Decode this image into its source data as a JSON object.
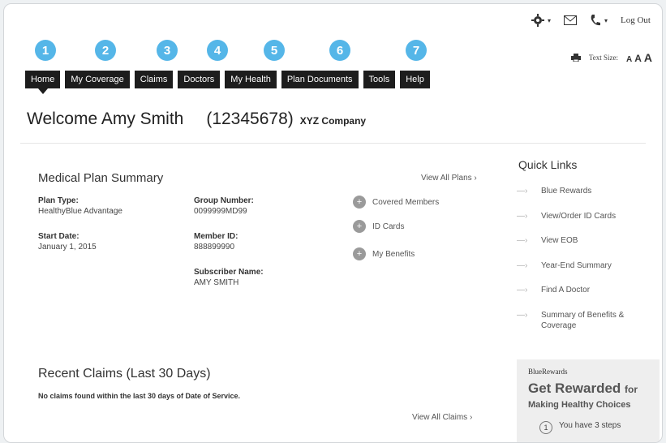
{
  "top_bar": {
    "icons": [
      "gear-icon",
      "mail-icon",
      "phone-icon"
    ],
    "logout_label": "Log Out"
  },
  "badges": [
    "1",
    "2",
    "3",
    "4",
    "5",
    "6",
    "7"
  ],
  "nav": {
    "tabs": [
      {
        "label": "Home",
        "active": true
      },
      {
        "label": "My Coverage"
      },
      {
        "label": "Claims"
      },
      {
        "label": "Doctors"
      },
      {
        "label": "My Health"
      },
      {
        "label": "Plan Documents"
      },
      {
        "label": "Tools"
      },
      {
        "label": "Help"
      }
    ]
  },
  "text_size": {
    "label": "Text Size:",
    "options": [
      "A",
      "A",
      "A"
    ]
  },
  "welcome": {
    "greeting": "Welcome Amy Smith",
    "member_id": "(12345678)",
    "company": "XYZ Company"
  },
  "plan_summary": {
    "title": "Medical Plan Summary",
    "view_all": "View All Plans",
    "plan_type_label": "Plan Type:",
    "plan_type_value": "HealthyBlue Advantage",
    "start_date_label": "Start Date:",
    "start_date_value": "January 1, 2015",
    "group_number_label": "Group Number:",
    "group_number_value": "0099999MD99",
    "member_id_label": "Member ID:",
    "member_id_value": "888899990",
    "subscriber_label": "Subscriber Name:",
    "subscriber_value": "AMY SMITH",
    "actions": [
      "Covered Members",
      "ID Cards",
      "My Benefits"
    ]
  },
  "recent_claims": {
    "title": "Recent Claims (Last 30 Days)",
    "message": "No claims found within the last 30 days of Date of Service.",
    "view_all": "View All Claims"
  },
  "quick_links": {
    "title": "Quick Links",
    "items": [
      "Blue Rewards",
      "View/Order ID Cards",
      "View EOB",
      "Year-End Summary",
      "Find A Doctor",
      "Summary of Benefits & Coverage"
    ]
  },
  "promo": {
    "brand": "BlueRewards",
    "headline": "Get Rewarded",
    "headline_suffix": "for",
    "subheadline": "Making Healthy Choices",
    "step_number": "1",
    "steps_text": "You have 3 steps"
  },
  "colors": {
    "badge": "#55b6e8",
    "nav": "#1d1d1d"
  }
}
